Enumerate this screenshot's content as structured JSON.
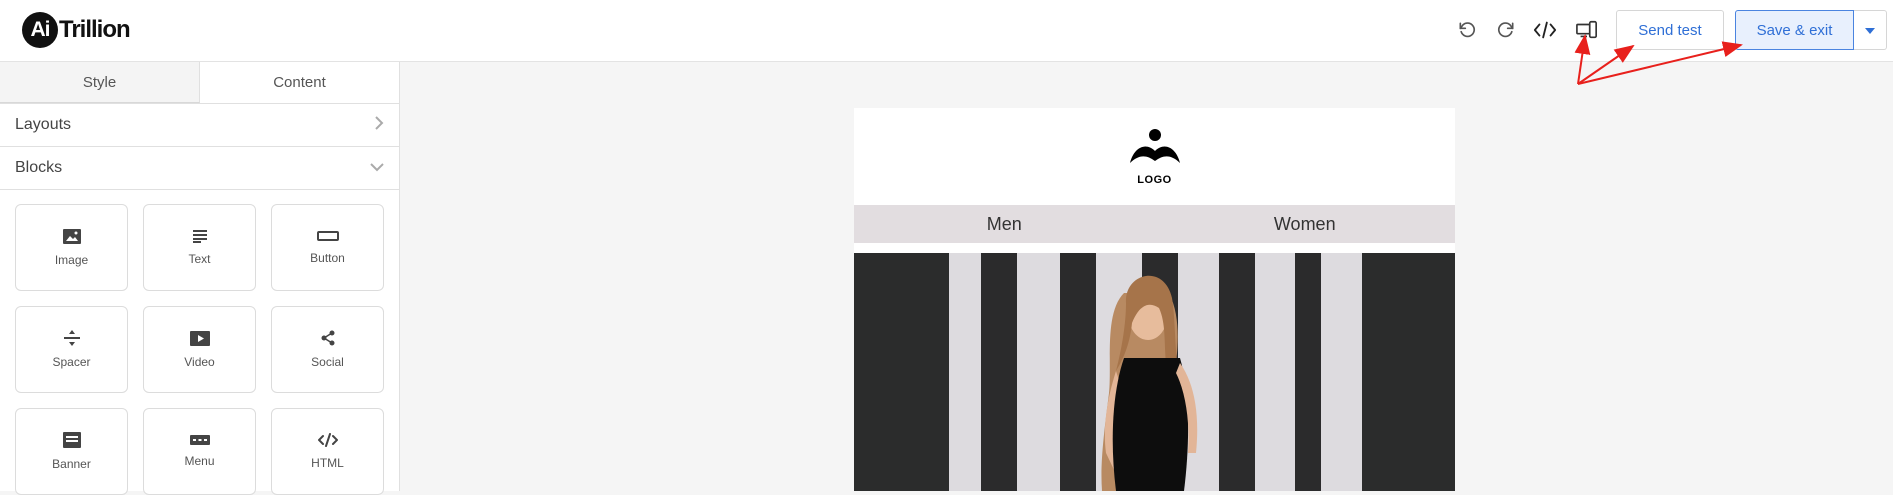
{
  "app": {
    "logo_badge": "Ai",
    "logo_text": "Trillion"
  },
  "toolbar": {
    "undo_icon": "undo-icon",
    "redo_icon": "redo-icon",
    "code_icon": "code-icon",
    "preview_icon": "responsive-preview-icon",
    "send_test_label": "Send test",
    "save_exit_label": "Save & exit",
    "dropdown_icon": "caret-down-icon",
    "accent_color": "#2f6fd6"
  },
  "sidebar": {
    "tabs": [
      {
        "label": "Style",
        "active": false
      },
      {
        "label": "Content",
        "active": true
      }
    ],
    "sections": [
      {
        "label": "Layouts",
        "icon": "chevron-right-icon"
      },
      {
        "label": "Blocks",
        "icon": "chevron-down-icon"
      }
    ],
    "blocks": [
      {
        "label": "Image",
        "icon": "image-icon"
      },
      {
        "label": "Text",
        "icon": "text-icon"
      },
      {
        "label": "Button",
        "icon": "button-icon"
      },
      {
        "label": "Spacer",
        "icon": "spacer-icon"
      },
      {
        "label": "Video",
        "icon": "video-icon"
      },
      {
        "label": "Social",
        "icon": "share-icon"
      },
      {
        "label": "Banner",
        "icon": "banner-icon"
      },
      {
        "label": "Menu",
        "icon": "menu-icon"
      },
      {
        "label": "HTML",
        "icon": "html-icon"
      }
    ]
  },
  "email": {
    "logo_text": "LOGO",
    "nav": [
      "Men",
      "Women"
    ],
    "nav_background": "#e2dde0"
  },
  "annotation": {
    "arrow_color": "#e8201c"
  }
}
